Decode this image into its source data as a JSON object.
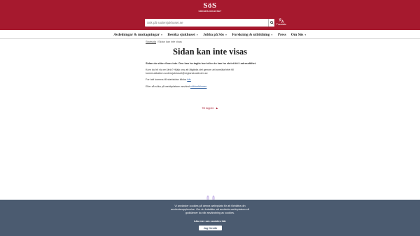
{
  "header": {
    "logo_mark": "SöS",
    "logo_sub": "SÖDERSJUKHUSET",
    "search": {
      "placeholder": "Sök på sodersjukhuset.se",
      "icon": "search-icon"
    },
    "translate_label": "Translate"
  },
  "nav": {
    "items": [
      {
        "label": "Avdelningar & mottagningar"
      },
      {
        "label": "Besöka sjukhuset"
      },
      {
        "label": "Jobba på Sös"
      },
      {
        "label": "Forskning & utbildning"
      },
      {
        "label": "Press"
      },
      {
        "label": "Om Sös"
      }
    ]
  },
  "breadcrumb": {
    "home": "Startsida",
    "sep": "/",
    "current": "Sidan kan inte visas"
  },
  "main": {
    "title": "Sidan kan inte visas",
    "lead": "Sidan du söker finns inte. Den kan ha tagits bort eller du kan ha skrivit fel i adressfältet.",
    "para1": "Kom du hit via en länk? Hjälp oss att åtgärda det genom att anmäla felet till kommunikation.sodersjukhuset@regionstockholm.se",
    "para2_pre": "Fort att komma till startsidan klicka ",
    "para2_link": "här",
    "para3_pre": "Eller så söka på webbplatsen använd ",
    "para3_link": "sökfunktionen"
  },
  "to_top": {
    "label": "Till toppen",
    "arrow": "▲"
  },
  "cookie": {
    "text": "Vi använder cookies på denna webbplats för att förbättra din användarupplevelse. Om du fortsätter att använda webbplatsen så godkänner du vår användning av cookies.",
    "more": "Läs mer om cookies här",
    "accept": "Jag förstår"
  },
  "colors": {
    "brand": "#a6192e",
    "cookie_bg": "#4b5b70",
    "link": "#2d5e9e"
  }
}
